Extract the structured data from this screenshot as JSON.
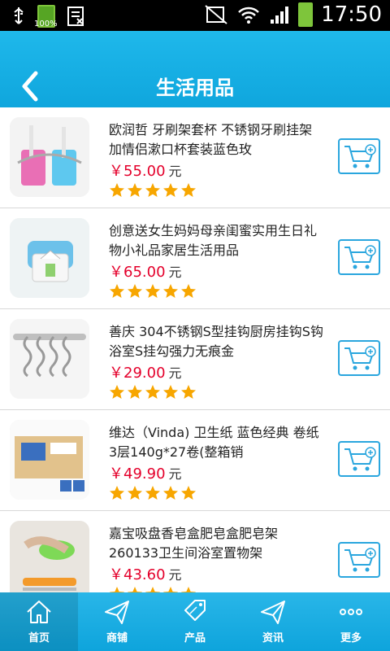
{
  "status_bar": {
    "time": "17:50",
    "battery_small_label": "100%"
  },
  "header": {
    "title": "生活用品"
  },
  "products": [
    {
      "name": "欧润哲 牙刷架套杯 不锈钢牙刷挂架加情侣漱口杯套装蓝色玫",
      "price": "￥55.00",
      "unit": "元",
      "rating": 5
    },
    {
      "name": "创意送女生妈妈母亲闺蜜实用生日礼物小礼品家居生活用品",
      "price": "￥65.00",
      "unit": "元",
      "rating": 5
    },
    {
      "name": "善庆 304不锈钢S型挂钩厨房挂钩S钩浴室S挂勾强力无痕金",
      "price": "￥29.00",
      "unit": "元",
      "rating": 5
    },
    {
      "name": "维达（Vinda) 卫生纸 蓝色经典 卷纸3层140g*27卷(整箱销",
      "price": "￥49.90",
      "unit": "元",
      "rating": 5
    },
    {
      "name": "嘉宝吸盘香皂盒肥皂盒肥皂架260133卫生间浴室置物架",
      "price": "￥43.60",
      "unit": "元",
      "rating": 5
    }
  ],
  "tabs": [
    {
      "label": "首页",
      "icon": "home-icon"
    },
    {
      "label": "商铺",
      "icon": "send-icon"
    },
    {
      "label": "产品",
      "icon": "sale-tag-icon"
    },
    {
      "label": "资讯",
      "icon": "send-icon"
    },
    {
      "label": "更多",
      "icon": "more-icon"
    }
  ],
  "colors": {
    "accent": "#0fa6dd",
    "price": "#e4002b",
    "star": "#f7a600"
  }
}
